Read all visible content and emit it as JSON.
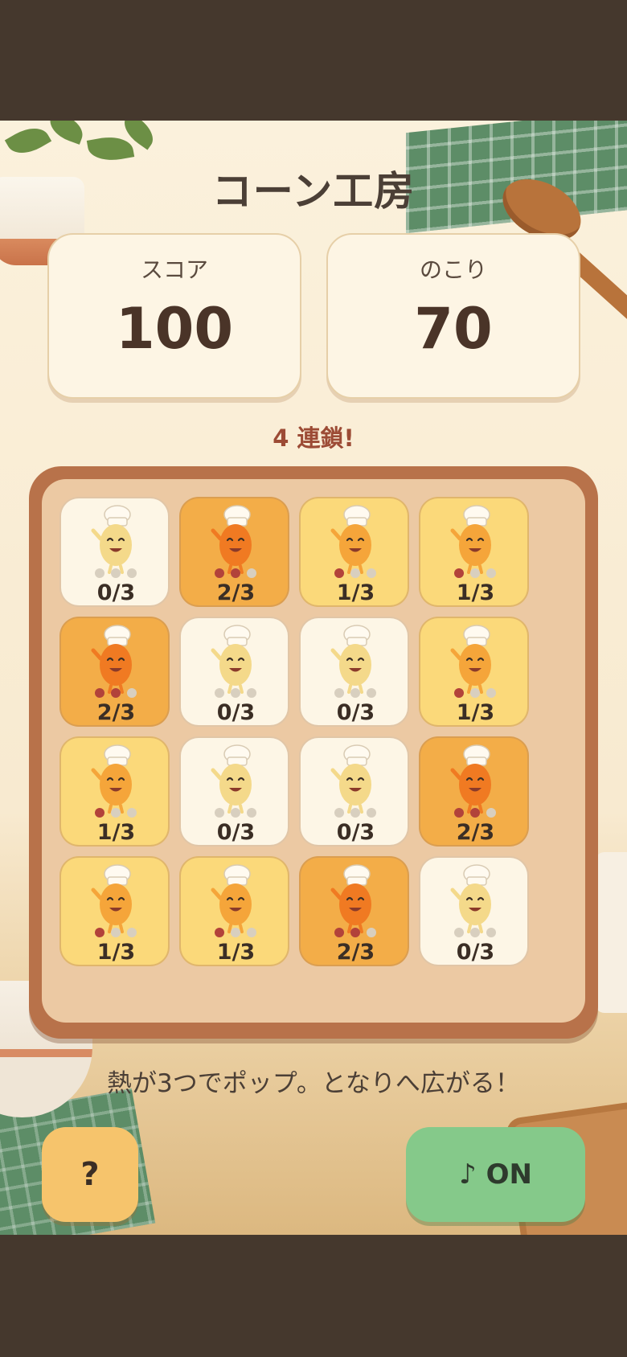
{
  "title": "コーン工房",
  "stats": {
    "score_label": "スコア",
    "score_value": "100",
    "remaining_label": "のこり",
    "remaining_value": "70"
  },
  "chain_text": "4 連鎖!",
  "board": {
    "max_heat": 3,
    "cells": [
      {
        "heat": 0,
        "label": "0/3"
      },
      {
        "heat": 2,
        "label": "2/3"
      },
      {
        "heat": 1,
        "label": "1/3"
      },
      {
        "heat": 1,
        "label": "1/3"
      },
      {
        "heat": 2,
        "label": "2/3"
      },
      {
        "heat": 0,
        "label": "0/3"
      },
      {
        "heat": 0,
        "label": "0/3"
      },
      {
        "heat": 1,
        "label": "1/3"
      },
      {
        "heat": 1,
        "label": "1/3"
      },
      {
        "heat": 0,
        "label": "0/3"
      },
      {
        "heat": 0,
        "label": "0/3"
      },
      {
        "heat": 2,
        "label": "2/3"
      },
      {
        "heat": 1,
        "label": "1/3"
      },
      {
        "heat": 1,
        "label": "1/3"
      },
      {
        "heat": 2,
        "label": "2/3"
      },
      {
        "heat": 0,
        "label": "0/3"
      }
    ]
  },
  "hint": "熱が3つでポップ。となりへ広がる！",
  "buttons": {
    "help_label": "?",
    "sound_label": "♪ ON"
  },
  "colors": {
    "heat0": "#fdf6e6",
    "heat1": "#fbd97a",
    "heat2": "#f3ad48",
    "sound_on": "#85c98a"
  }
}
